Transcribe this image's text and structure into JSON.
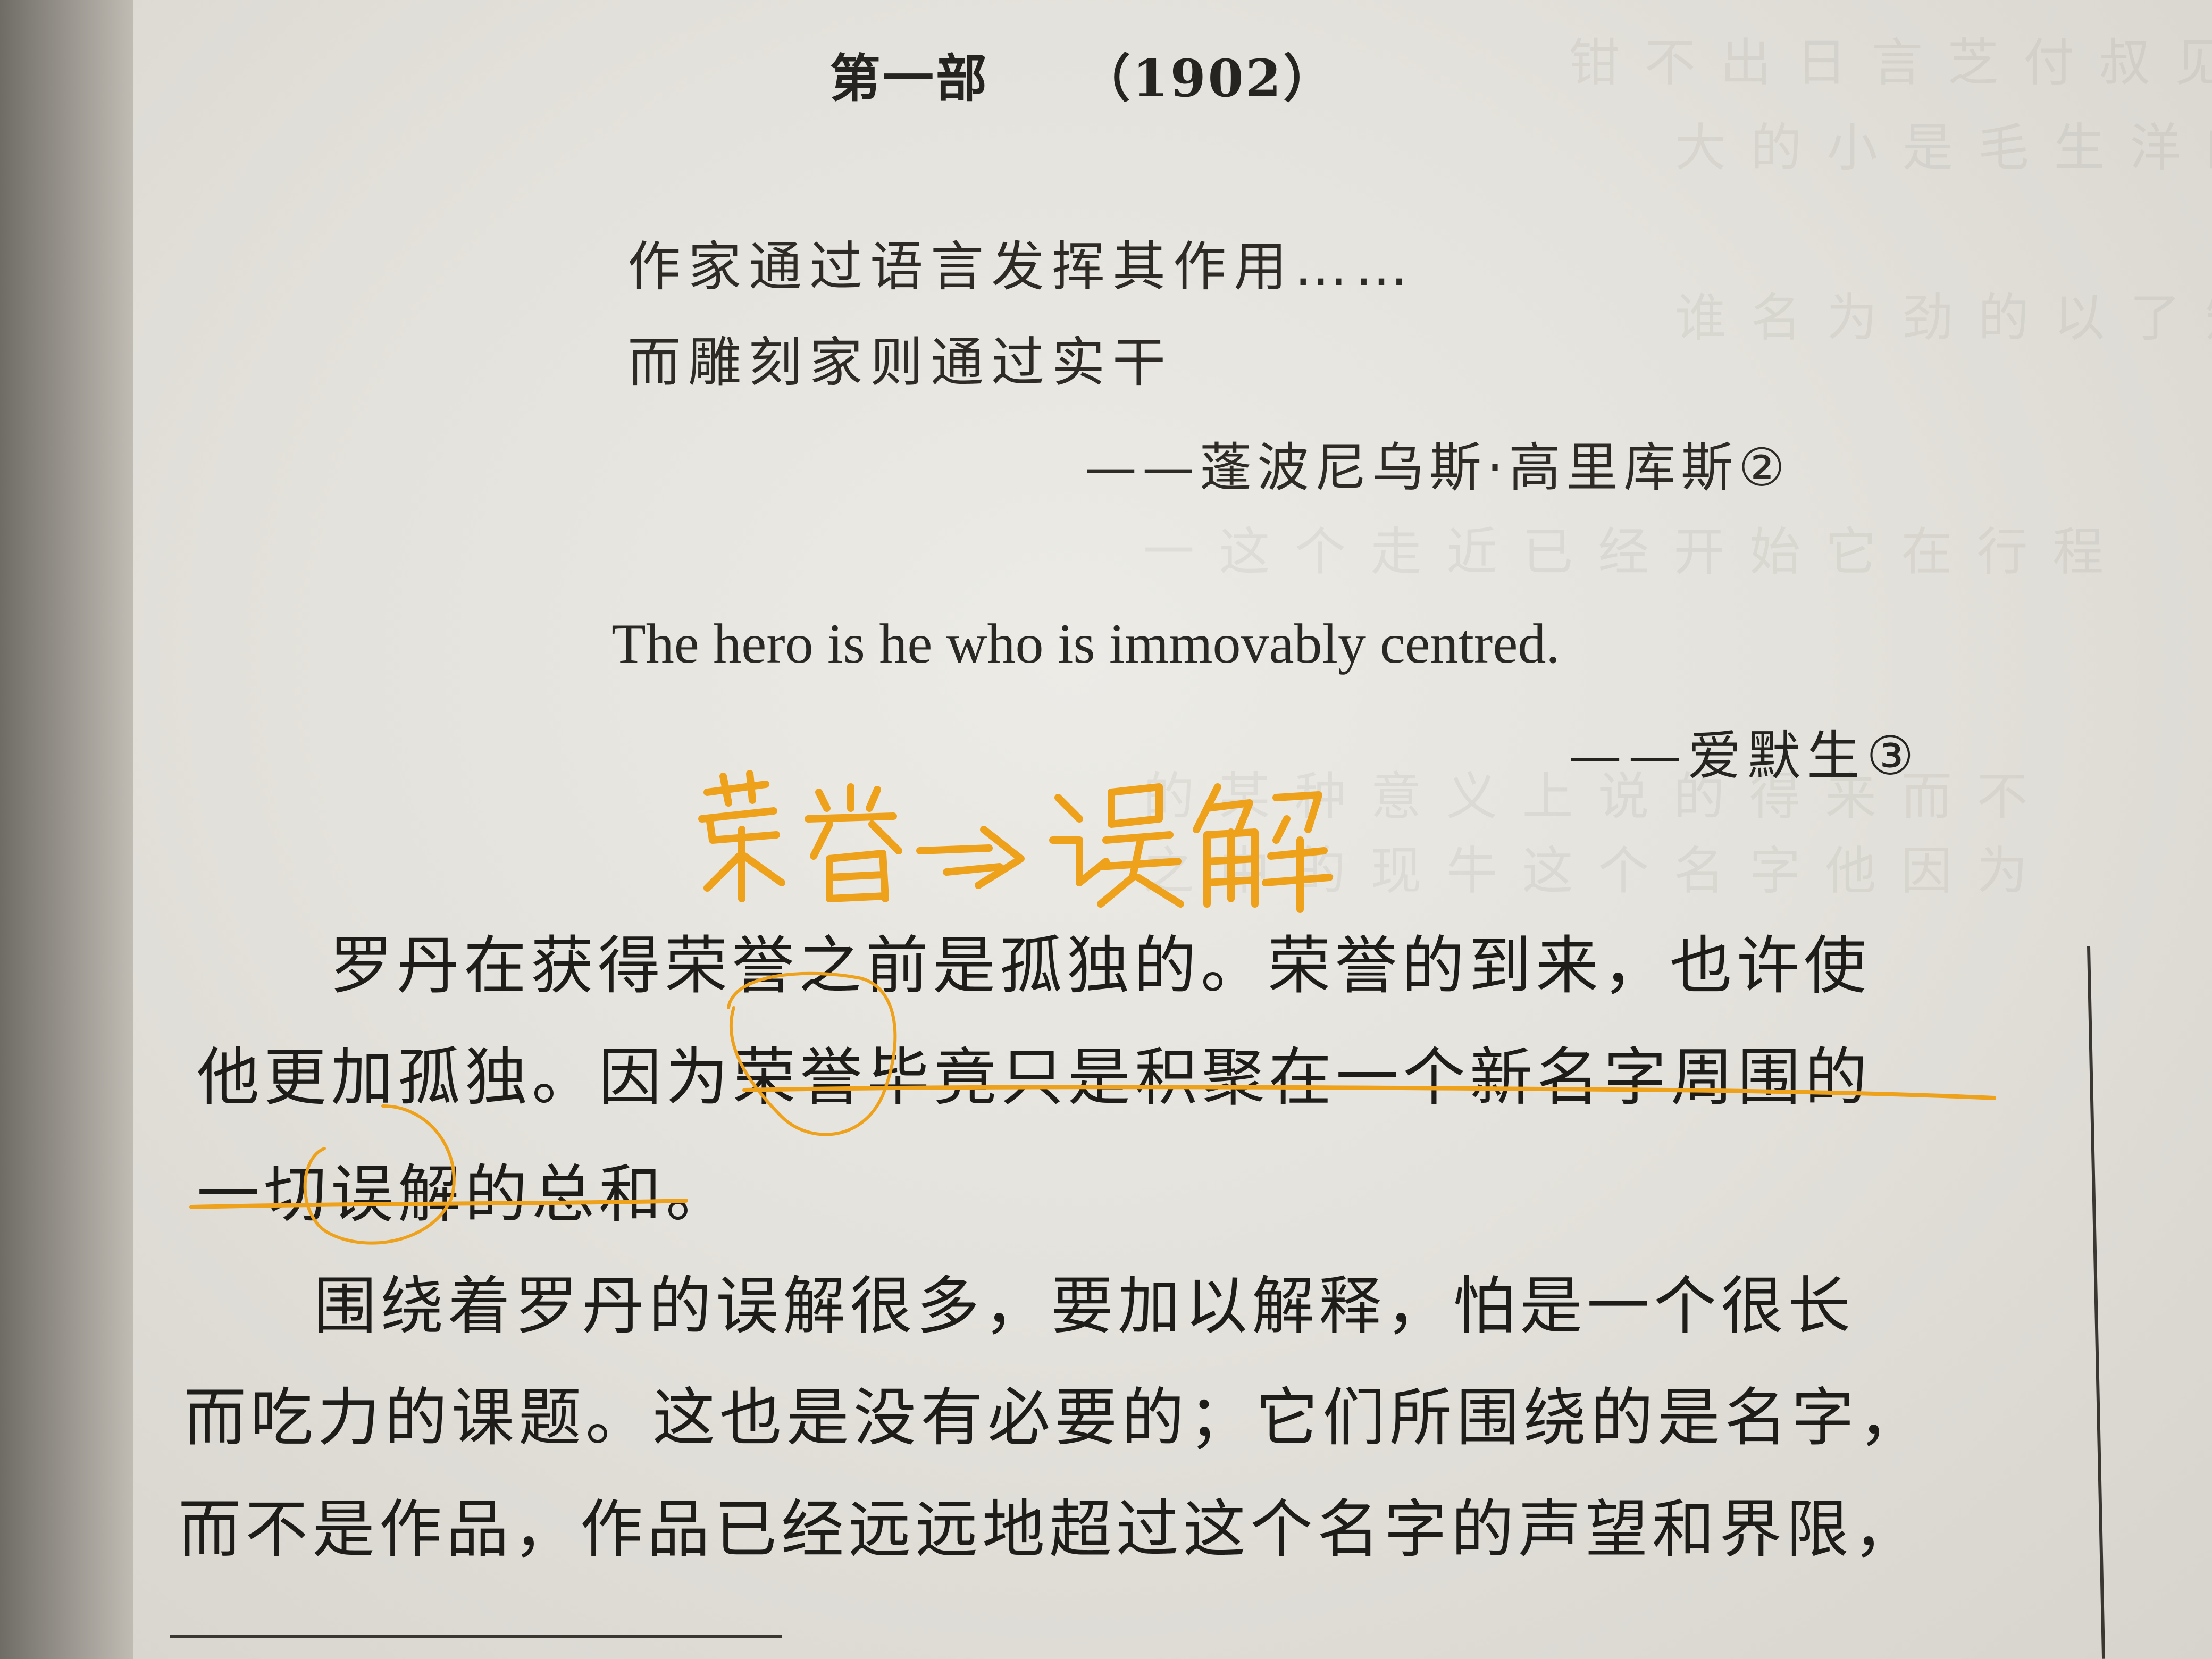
{
  "heading": {
    "part": "第一部",
    "year": "（1902）"
  },
  "epigraph_1": {
    "line_1": "作家通过语言发挥其作用……",
    "line_2": "而雕刻家则通过实干",
    "attribution": "——蓬波尼乌斯·高里库斯②"
  },
  "epigraph_2": {
    "quote": "The hero is he who is immovably centred.",
    "attribution": "——爱默生③"
  },
  "handwritten_note": "荣誉→误解",
  "body": {
    "line_1": "罗丹在获得荣誉之前是孤独的。荣誉的到来，也许使",
    "line_2": "他更加孤独。因为荣誉毕竟只是积聚在一个新名字周围的",
    "line_3": "一切误解的总和。",
    "line_4": "围绕着罗丹的误解很多，要加以解释，怕是一个很长",
    "line_5": "而吃力的课题。这也是没有必要的；它们所围绕的是名字，",
    "line_6": "而不是作品，作品已经远远地超过这个名字的声望和界限，"
  },
  "colors": {
    "ink": "#262421",
    "highlighter": "#eea21c",
    "paper": "#e6e4de"
  }
}
